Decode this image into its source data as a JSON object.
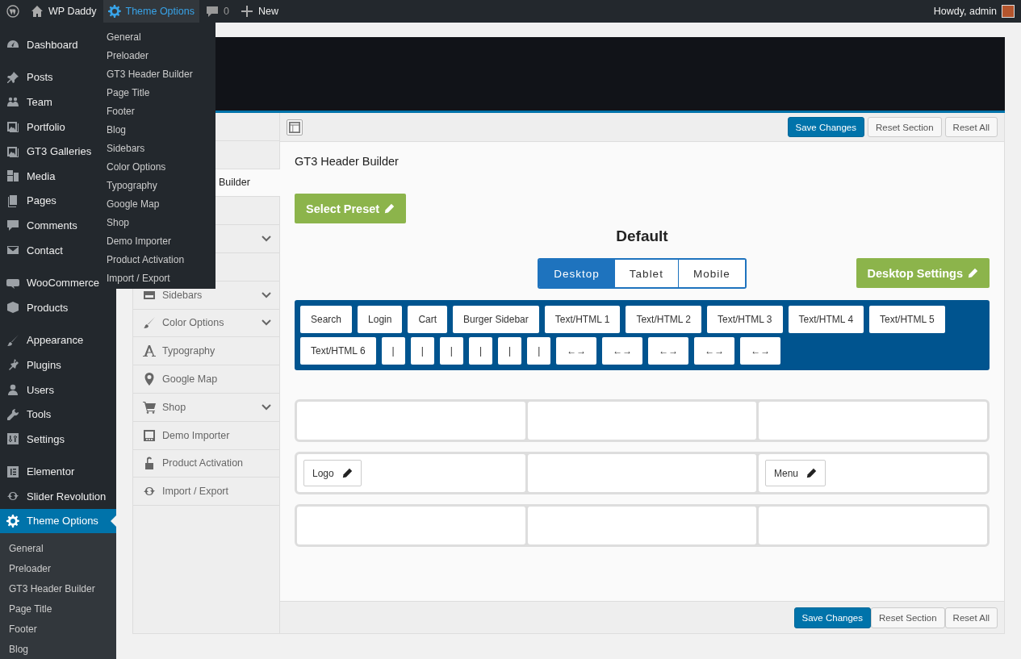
{
  "admin_bar": {
    "site": "WP Daddy",
    "theme_options": "Theme Options",
    "comments": "0",
    "new": "New",
    "greeting": "Howdy, admin"
  },
  "theme_dropdown": [
    "General",
    "Preloader",
    "GT3 Header Builder",
    "Page Title",
    "Footer",
    "Blog",
    "Sidebars",
    "Color Options",
    "Typography",
    "Google Map",
    "Shop",
    "Demo Importer",
    "Product Activation",
    "Import / Export"
  ],
  "sidebar": {
    "groups": [
      [
        {
          "label": "Dashboard",
          "selected": false
        }
      ],
      [
        {
          "label": "Posts",
          "selected": false
        },
        {
          "label": "Team",
          "selected": false
        },
        {
          "label": "Portfolio",
          "selected": false
        },
        {
          "label": "GT3 Galleries",
          "selected": false
        },
        {
          "label": "Media",
          "selected": false
        },
        {
          "label": "Pages",
          "selected": false
        },
        {
          "label": "Comments",
          "selected": false
        },
        {
          "label": "Contact",
          "selected": false
        }
      ],
      [
        {
          "label": "WooCommerce",
          "selected": false
        },
        {
          "label": "Products",
          "selected": false
        }
      ],
      [
        {
          "label": "Appearance",
          "selected": false
        },
        {
          "label": "Plugins",
          "selected": false
        },
        {
          "label": "Users",
          "selected": false
        },
        {
          "label": "Tools",
          "selected": false
        },
        {
          "label": "Settings",
          "selected": false
        }
      ],
      [
        {
          "label": "Elementor",
          "selected": false
        },
        {
          "label": "Slider Revolution",
          "selected": false
        },
        {
          "label": "Theme Options",
          "selected": true,
          "children": [
            {
              "label": "General",
              "selected": false
            },
            {
              "label": "Preloader",
              "selected": false
            },
            {
              "label": "GT3 Header Builder",
              "selected": false
            },
            {
              "label": "Page Title",
              "selected": false
            },
            {
              "label": "Footer",
              "selected": false
            },
            {
              "label": "Blog",
              "selected": false
            }
          ]
        }
      ]
    ]
  },
  "options_nav": [
    {
      "selected": false,
      "has_submenu": false
    },
    {
      "selected": false,
      "has_submenu": false
    },
    {
      "label": "Builder",
      "selected": true,
      "has_submenu": false,
      "covered": true
    },
    {
      "selected": false,
      "has_submenu": false
    },
    {
      "selected": false,
      "has_submenu": true
    },
    {
      "selected": false,
      "has_submenu": false
    },
    {
      "label": "Sidebars",
      "selected": false,
      "has_submenu": true
    },
    {
      "label": "Color Options",
      "selected": false,
      "has_submenu": true
    },
    {
      "label": "Typography",
      "selected": false,
      "has_submenu": false
    },
    {
      "label": "Google Map",
      "selected": false,
      "has_submenu": false
    },
    {
      "label": "Shop",
      "selected": false,
      "has_submenu": true
    },
    {
      "label": "Demo Importer",
      "selected": false,
      "has_submenu": false
    },
    {
      "label": "Product Activation",
      "selected": false,
      "has_submenu": false
    },
    {
      "label": "Import / Export",
      "selected": false,
      "has_submenu": false
    }
  ],
  "toolbar_buttons": [
    {
      "label": "Save Changes",
      "kind": "primary"
    },
    {
      "label": "Reset Section",
      "kind": "secondary"
    },
    {
      "label": "Reset All",
      "kind": "secondary"
    }
  ],
  "builder": {
    "title": "GT3 Header Builder",
    "preset_button": "Select Preset",
    "preset_name": "Default",
    "device_tabs": [
      {
        "label": "Desktop",
        "selected": true
      },
      {
        "label": "Tablet",
        "selected": false
      },
      {
        "label": "Mobile",
        "selected": false
      }
    ],
    "settings_button": "Desktop Settings",
    "elements": [
      "Search",
      "Login",
      "Cart",
      "Burger Sidebar",
      "Text/HTML 1",
      "Text/HTML 2",
      "Text/HTML 3",
      "Text/HTML 4",
      "Text/HTML 5",
      "Text/HTML 6",
      "|",
      "|",
      "|",
      "|",
      "|",
      "|",
      "←→",
      "←→",
      "←→",
      "←→",
      "←→"
    ],
    "zones": [
      {
        "cells": [
          {
            "kind": "empty"
          },
          {
            "kind": "empty"
          },
          {
            "kind": "empty"
          }
        ]
      },
      {
        "cells": [
          {
            "kind": "element",
            "label": "Logo"
          },
          {
            "kind": "empty"
          },
          {
            "kind": "element",
            "label": "Menu"
          }
        ]
      },
      {
        "cells": [
          {
            "kind": "empty"
          },
          {
            "kind": "empty"
          },
          {
            "kind": "empty"
          }
        ]
      }
    ]
  },
  "footer_buttons": [
    {
      "label": "Save Changes",
      "kind": "primary"
    },
    {
      "label": "Reset Section",
      "kind": "secondary"
    },
    {
      "label": "Reset All",
      "kind": "secondary"
    }
  ]
}
